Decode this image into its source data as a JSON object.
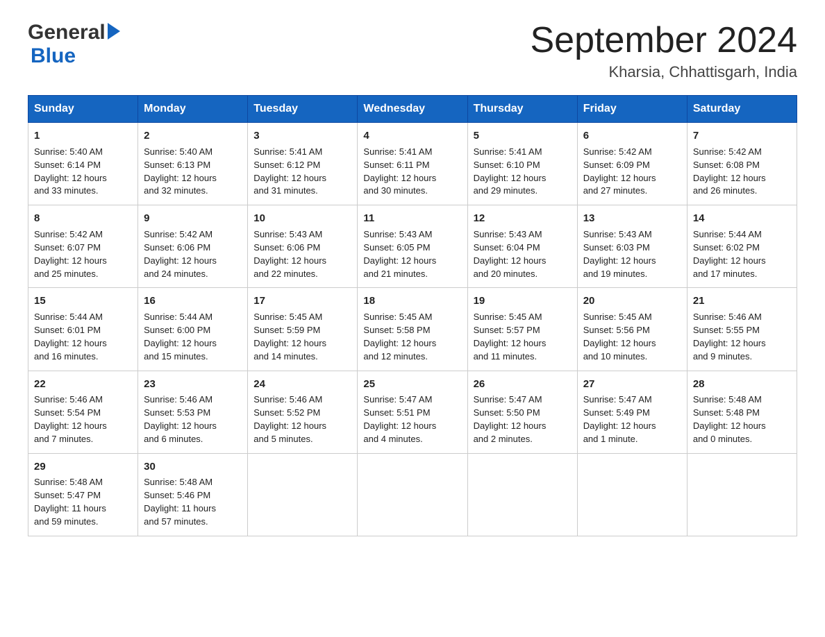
{
  "header": {
    "logo_general": "General",
    "logo_blue": "Blue",
    "month_year": "September 2024",
    "location": "Kharsia, Chhattisgarh, India"
  },
  "weekdays": [
    "Sunday",
    "Monday",
    "Tuesday",
    "Wednesday",
    "Thursday",
    "Friday",
    "Saturday"
  ],
  "weeks": [
    [
      {
        "day": "1",
        "sunrise": "5:40 AM",
        "sunset": "6:14 PM",
        "daylight": "12 hours and 33 minutes."
      },
      {
        "day": "2",
        "sunrise": "5:40 AM",
        "sunset": "6:13 PM",
        "daylight": "12 hours and 32 minutes."
      },
      {
        "day": "3",
        "sunrise": "5:41 AM",
        "sunset": "6:12 PM",
        "daylight": "12 hours and 31 minutes."
      },
      {
        "day": "4",
        "sunrise": "5:41 AM",
        "sunset": "6:11 PM",
        "daylight": "12 hours and 30 minutes."
      },
      {
        "day": "5",
        "sunrise": "5:41 AM",
        "sunset": "6:10 PM",
        "daylight": "12 hours and 29 minutes."
      },
      {
        "day": "6",
        "sunrise": "5:42 AM",
        "sunset": "6:09 PM",
        "daylight": "12 hours and 27 minutes."
      },
      {
        "day": "7",
        "sunrise": "5:42 AM",
        "sunset": "6:08 PM",
        "daylight": "12 hours and 26 minutes."
      }
    ],
    [
      {
        "day": "8",
        "sunrise": "5:42 AM",
        "sunset": "6:07 PM",
        "daylight": "12 hours and 25 minutes."
      },
      {
        "day": "9",
        "sunrise": "5:42 AM",
        "sunset": "6:06 PM",
        "daylight": "12 hours and 24 minutes."
      },
      {
        "day": "10",
        "sunrise": "5:43 AM",
        "sunset": "6:06 PM",
        "daylight": "12 hours and 22 minutes."
      },
      {
        "day": "11",
        "sunrise": "5:43 AM",
        "sunset": "6:05 PM",
        "daylight": "12 hours and 21 minutes."
      },
      {
        "day": "12",
        "sunrise": "5:43 AM",
        "sunset": "6:04 PM",
        "daylight": "12 hours and 20 minutes."
      },
      {
        "day": "13",
        "sunrise": "5:43 AM",
        "sunset": "6:03 PM",
        "daylight": "12 hours and 19 minutes."
      },
      {
        "day": "14",
        "sunrise": "5:44 AM",
        "sunset": "6:02 PM",
        "daylight": "12 hours and 17 minutes."
      }
    ],
    [
      {
        "day": "15",
        "sunrise": "5:44 AM",
        "sunset": "6:01 PM",
        "daylight": "12 hours and 16 minutes."
      },
      {
        "day": "16",
        "sunrise": "5:44 AM",
        "sunset": "6:00 PM",
        "daylight": "12 hours and 15 minutes."
      },
      {
        "day": "17",
        "sunrise": "5:45 AM",
        "sunset": "5:59 PM",
        "daylight": "12 hours and 14 minutes."
      },
      {
        "day": "18",
        "sunrise": "5:45 AM",
        "sunset": "5:58 PM",
        "daylight": "12 hours and 12 minutes."
      },
      {
        "day": "19",
        "sunrise": "5:45 AM",
        "sunset": "5:57 PM",
        "daylight": "12 hours and 11 minutes."
      },
      {
        "day": "20",
        "sunrise": "5:45 AM",
        "sunset": "5:56 PM",
        "daylight": "12 hours and 10 minutes."
      },
      {
        "day": "21",
        "sunrise": "5:46 AM",
        "sunset": "5:55 PM",
        "daylight": "12 hours and 9 minutes."
      }
    ],
    [
      {
        "day": "22",
        "sunrise": "5:46 AM",
        "sunset": "5:54 PM",
        "daylight": "12 hours and 7 minutes."
      },
      {
        "day": "23",
        "sunrise": "5:46 AM",
        "sunset": "5:53 PM",
        "daylight": "12 hours and 6 minutes."
      },
      {
        "day": "24",
        "sunrise": "5:46 AM",
        "sunset": "5:52 PM",
        "daylight": "12 hours and 5 minutes."
      },
      {
        "day": "25",
        "sunrise": "5:47 AM",
        "sunset": "5:51 PM",
        "daylight": "12 hours and 4 minutes."
      },
      {
        "day": "26",
        "sunrise": "5:47 AM",
        "sunset": "5:50 PM",
        "daylight": "12 hours and 2 minutes."
      },
      {
        "day": "27",
        "sunrise": "5:47 AM",
        "sunset": "5:49 PM",
        "daylight": "12 hours and 1 minute."
      },
      {
        "day": "28",
        "sunrise": "5:48 AM",
        "sunset": "5:48 PM",
        "daylight": "12 hours and 0 minutes."
      }
    ],
    [
      {
        "day": "29",
        "sunrise": "5:48 AM",
        "sunset": "5:47 PM",
        "daylight": "11 hours and 59 minutes."
      },
      {
        "day": "30",
        "sunrise": "5:48 AM",
        "sunset": "5:46 PM",
        "daylight": "11 hours and 57 minutes."
      },
      null,
      null,
      null,
      null,
      null
    ]
  ],
  "labels": {
    "sunrise": "Sunrise:",
    "sunset": "Sunset:",
    "daylight": "Daylight:"
  }
}
